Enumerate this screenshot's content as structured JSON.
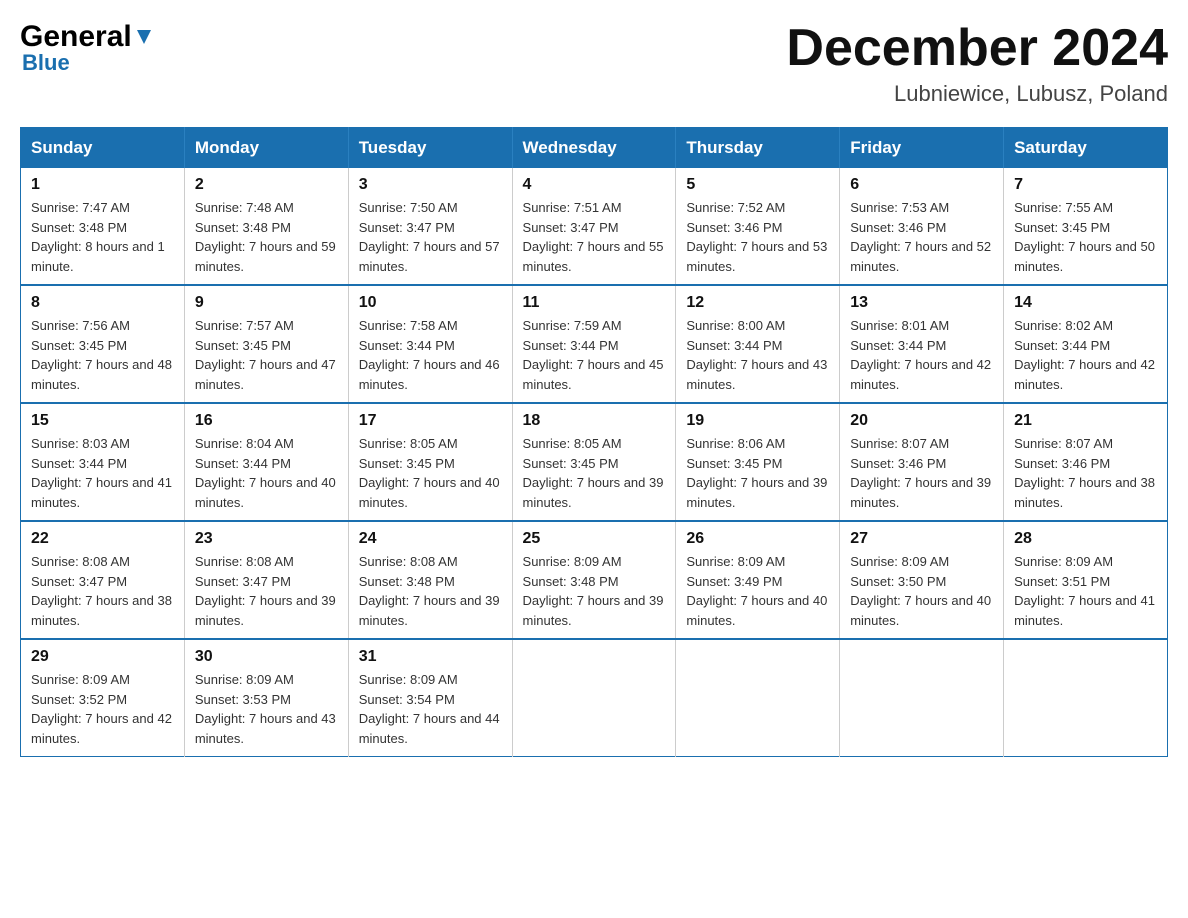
{
  "header": {
    "logo": {
      "general": "General",
      "blue": "Blue"
    },
    "title": "December 2024",
    "subtitle": "Lubniewice, Lubusz, Poland"
  },
  "weekdays": [
    "Sunday",
    "Monday",
    "Tuesday",
    "Wednesday",
    "Thursday",
    "Friday",
    "Saturday"
  ],
  "weeks": [
    [
      {
        "day": "1",
        "sunrise": "7:47 AM",
        "sunset": "3:48 PM",
        "daylight": "8 hours and 1 minute."
      },
      {
        "day": "2",
        "sunrise": "7:48 AM",
        "sunset": "3:48 PM",
        "daylight": "7 hours and 59 minutes."
      },
      {
        "day": "3",
        "sunrise": "7:50 AM",
        "sunset": "3:47 PM",
        "daylight": "7 hours and 57 minutes."
      },
      {
        "day": "4",
        "sunrise": "7:51 AM",
        "sunset": "3:47 PM",
        "daylight": "7 hours and 55 minutes."
      },
      {
        "day": "5",
        "sunrise": "7:52 AM",
        "sunset": "3:46 PM",
        "daylight": "7 hours and 53 minutes."
      },
      {
        "day": "6",
        "sunrise": "7:53 AM",
        "sunset": "3:46 PM",
        "daylight": "7 hours and 52 minutes."
      },
      {
        "day": "7",
        "sunrise": "7:55 AM",
        "sunset": "3:45 PM",
        "daylight": "7 hours and 50 minutes."
      }
    ],
    [
      {
        "day": "8",
        "sunrise": "7:56 AM",
        "sunset": "3:45 PM",
        "daylight": "7 hours and 48 minutes."
      },
      {
        "day": "9",
        "sunrise": "7:57 AM",
        "sunset": "3:45 PM",
        "daylight": "7 hours and 47 minutes."
      },
      {
        "day": "10",
        "sunrise": "7:58 AM",
        "sunset": "3:44 PM",
        "daylight": "7 hours and 46 minutes."
      },
      {
        "day": "11",
        "sunrise": "7:59 AM",
        "sunset": "3:44 PM",
        "daylight": "7 hours and 45 minutes."
      },
      {
        "day": "12",
        "sunrise": "8:00 AM",
        "sunset": "3:44 PM",
        "daylight": "7 hours and 43 minutes."
      },
      {
        "day": "13",
        "sunrise": "8:01 AM",
        "sunset": "3:44 PM",
        "daylight": "7 hours and 42 minutes."
      },
      {
        "day": "14",
        "sunrise": "8:02 AM",
        "sunset": "3:44 PM",
        "daylight": "7 hours and 42 minutes."
      }
    ],
    [
      {
        "day": "15",
        "sunrise": "8:03 AM",
        "sunset": "3:44 PM",
        "daylight": "7 hours and 41 minutes."
      },
      {
        "day": "16",
        "sunrise": "8:04 AM",
        "sunset": "3:44 PM",
        "daylight": "7 hours and 40 minutes."
      },
      {
        "day": "17",
        "sunrise": "8:05 AM",
        "sunset": "3:45 PM",
        "daylight": "7 hours and 40 minutes."
      },
      {
        "day": "18",
        "sunrise": "8:05 AM",
        "sunset": "3:45 PM",
        "daylight": "7 hours and 39 minutes."
      },
      {
        "day": "19",
        "sunrise": "8:06 AM",
        "sunset": "3:45 PM",
        "daylight": "7 hours and 39 minutes."
      },
      {
        "day": "20",
        "sunrise": "8:07 AM",
        "sunset": "3:46 PM",
        "daylight": "7 hours and 39 minutes."
      },
      {
        "day": "21",
        "sunrise": "8:07 AM",
        "sunset": "3:46 PM",
        "daylight": "7 hours and 38 minutes."
      }
    ],
    [
      {
        "day": "22",
        "sunrise": "8:08 AM",
        "sunset": "3:47 PM",
        "daylight": "7 hours and 38 minutes."
      },
      {
        "day": "23",
        "sunrise": "8:08 AM",
        "sunset": "3:47 PM",
        "daylight": "7 hours and 39 minutes."
      },
      {
        "day": "24",
        "sunrise": "8:08 AM",
        "sunset": "3:48 PM",
        "daylight": "7 hours and 39 minutes."
      },
      {
        "day": "25",
        "sunrise": "8:09 AM",
        "sunset": "3:48 PM",
        "daylight": "7 hours and 39 minutes."
      },
      {
        "day": "26",
        "sunrise": "8:09 AM",
        "sunset": "3:49 PM",
        "daylight": "7 hours and 40 minutes."
      },
      {
        "day": "27",
        "sunrise": "8:09 AM",
        "sunset": "3:50 PM",
        "daylight": "7 hours and 40 minutes."
      },
      {
        "day": "28",
        "sunrise": "8:09 AM",
        "sunset": "3:51 PM",
        "daylight": "7 hours and 41 minutes."
      }
    ],
    [
      {
        "day": "29",
        "sunrise": "8:09 AM",
        "sunset": "3:52 PM",
        "daylight": "7 hours and 42 minutes."
      },
      {
        "day": "30",
        "sunrise": "8:09 AM",
        "sunset": "3:53 PM",
        "daylight": "7 hours and 43 minutes."
      },
      {
        "day": "31",
        "sunrise": "8:09 AM",
        "sunset": "3:54 PM",
        "daylight": "7 hours and 44 minutes."
      },
      null,
      null,
      null,
      null
    ]
  ],
  "labels": {
    "sunrise_prefix": "Sunrise: ",
    "sunset_prefix": "Sunset: ",
    "daylight_prefix": "Daylight: "
  }
}
